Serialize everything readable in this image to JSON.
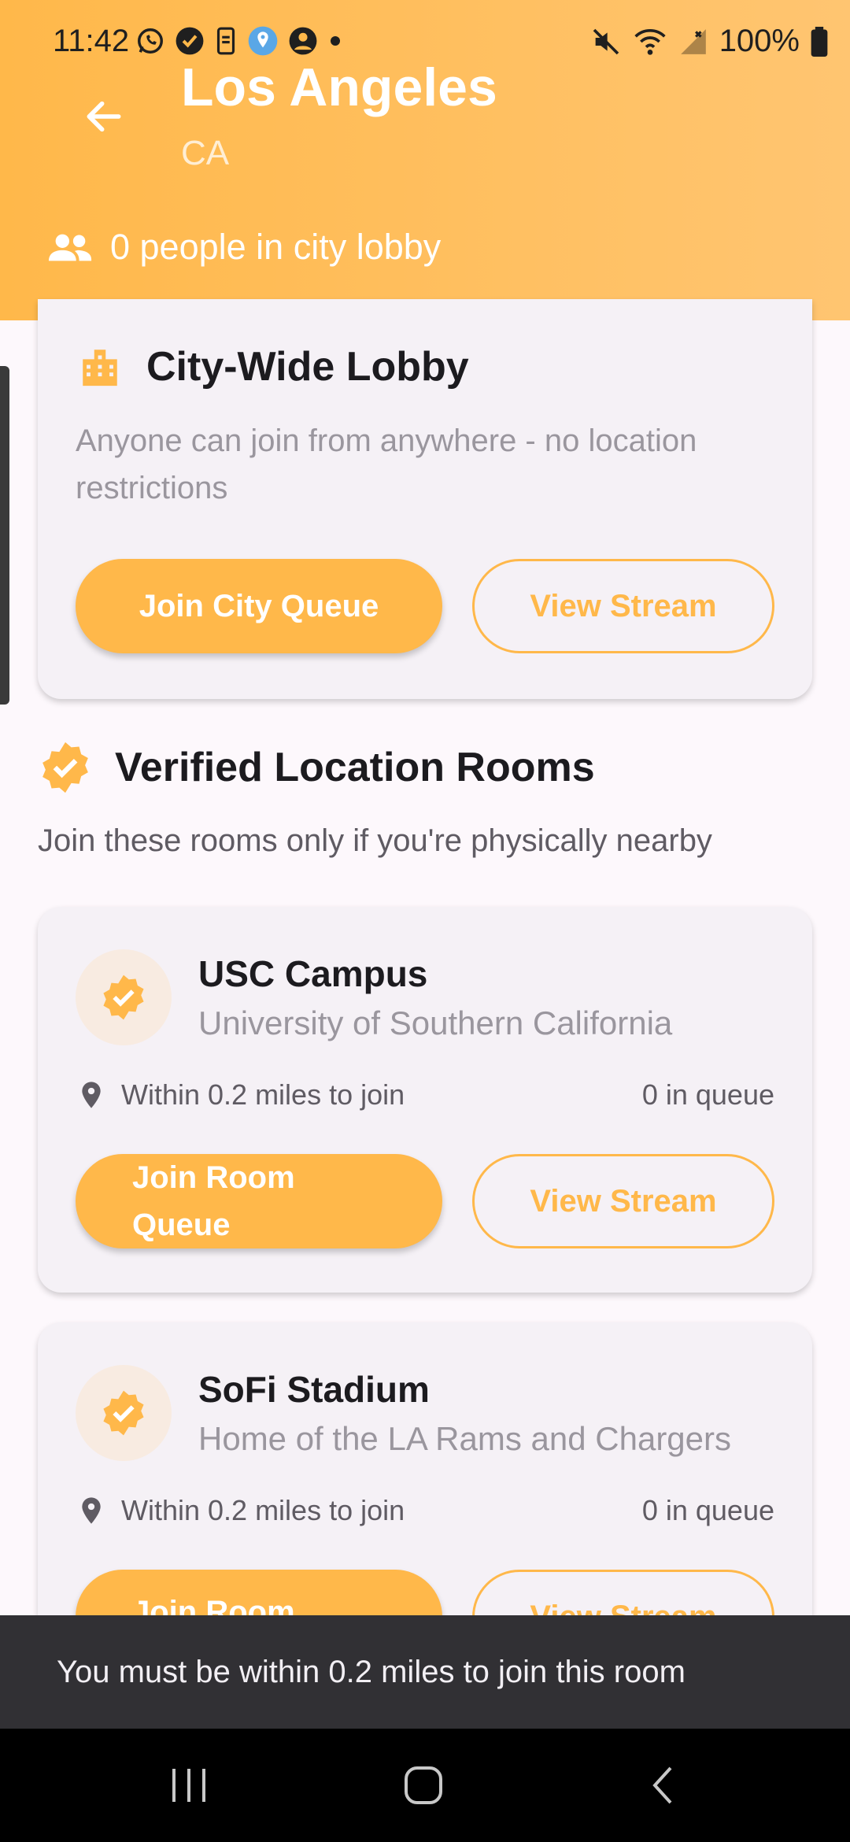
{
  "status_bar": {
    "time": "11:42",
    "battery": "100%"
  },
  "header": {
    "title": "Los Angeles",
    "subtitle": "CA",
    "lobby_count": "0 people in city lobby"
  },
  "city_lobby": {
    "title": "City-Wide Lobby",
    "description": "Anyone can join from anywhere - no location restrictions",
    "join_label": "Join City Queue",
    "stream_label": "View Stream"
  },
  "verified_section": {
    "title": "Verified Location Rooms",
    "subtitle": "Join these rooms only if you're physically nearby"
  },
  "rooms": [
    {
      "name": "USC Campus",
      "description": "University of Southern California",
      "distance": "Within 0.2 miles to join",
      "queue": "0 in queue",
      "join_label": "Join Room Queue",
      "stream_label": "View Stream"
    },
    {
      "name": "SoFi Stadium",
      "description": "Home of the LA Rams and Chargers",
      "distance": "Within 0.2 miles to join",
      "queue": "0 in queue",
      "join_label": "Join Room",
      "stream_label": "View Stream"
    }
  ],
  "snackbar": {
    "message": "You must be within 0.2 miles to join this room"
  },
  "colors": {
    "accent": "#ffb84a",
    "background": "#fdf8fc",
    "card": "#f5f1f6",
    "snackbar": "#313034"
  },
  "icons": {
    "back": "arrow-left-icon",
    "people": "group-icon",
    "city": "building-icon",
    "verified": "verified-badge-icon",
    "location": "map-pin-icon"
  }
}
